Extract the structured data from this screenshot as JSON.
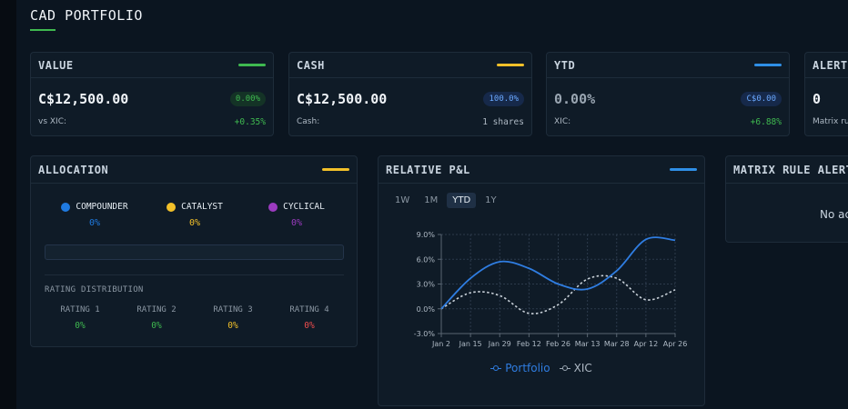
{
  "page": {
    "title": "CAD PORTFOLIO"
  },
  "colors": {
    "green": "#3fb950",
    "yellow": "#f2c029",
    "blue": "#2f8fe6",
    "red": "#f04d4d"
  },
  "stats": [
    {
      "title": "VALUE",
      "accent": "green-line",
      "value": "C$12,500.00",
      "badge": "0.00%",
      "sub_label": "vs XIC:",
      "sub_value": "+0.35%"
    },
    {
      "title": "CASH",
      "accent": "yellow-line",
      "value": "C$12,500.00",
      "badge": "100.0%",
      "sub_label": "Cash:",
      "sub_value": "1 shares"
    },
    {
      "title": "YTD",
      "accent": "blue-line",
      "value": "0.00%",
      "badge": "C$0.00",
      "sub_label": "XIC:",
      "sub_value": "+6.88%"
    },
    {
      "title": "ALERTS",
      "value": "0",
      "sub_label": "Matrix ru"
    }
  ],
  "allocation": {
    "title": "ALLOCATION",
    "items": [
      {
        "label": "COMPOUNDER",
        "value": "0%",
        "color": "#1f7ae0",
        "icon": "blue-dot-icon"
      },
      {
        "label": "CATALYST",
        "value": "0%",
        "color": "#f2c029",
        "icon": "yellow-dot-icon"
      },
      {
        "label": "CYCLICAL",
        "value": "0%",
        "color": "#9b3bbf",
        "icon": "purple-dot-icon"
      }
    ],
    "rating_title": "RATING DISTRIBUTION",
    "ratings": [
      {
        "label": "RATING 1",
        "value": "0%",
        "color": "#3fb950"
      },
      {
        "label": "RATING 2",
        "value": "0%",
        "color": "#3fb950"
      },
      {
        "label": "RATING 3",
        "value": "0%",
        "color": "#f2c029"
      },
      {
        "label": "RATING 4",
        "value": "0%",
        "color": "#f04d4d"
      }
    ]
  },
  "pnl": {
    "title": "RELATIVE P&L",
    "tabs": [
      "1W",
      "1M",
      "YTD",
      "1Y"
    ],
    "active_tab": "YTD"
  },
  "alerts_panel": {
    "title": "MATRIX RULE ALERTS",
    "empty_text": "No ac"
  },
  "chart_data": {
    "type": "line",
    "x": [
      "Jan 2",
      "Jan 15",
      "Jan 29",
      "Feb 12",
      "Feb 26",
      "Mar 13",
      "Mar 28",
      "Apr 12",
      "Apr 26"
    ],
    "y_ticks": [
      "9.0%",
      "6.0%",
      "3.0%",
      "0.0%",
      "-3.0%"
    ],
    "ylim": [
      -3,
      9
    ],
    "grid": true,
    "legend": "bottom",
    "series": [
      {
        "name": "Portfolio",
        "color": "#2f7de1",
        "style": "solid",
        "values": [
          0.0,
          3.7,
          5.7,
          4.9,
          3.0,
          2.4,
          4.6,
          8.4,
          8.3
        ]
      },
      {
        "name": "XIC",
        "color": "#c9d1d9",
        "style": "dashed",
        "values": [
          0.0,
          1.95,
          1.6,
          -0.55,
          0.5,
          3.6,
          3.7,
          1.1,
          2.3
        ]
      }
    ]
  }
}
